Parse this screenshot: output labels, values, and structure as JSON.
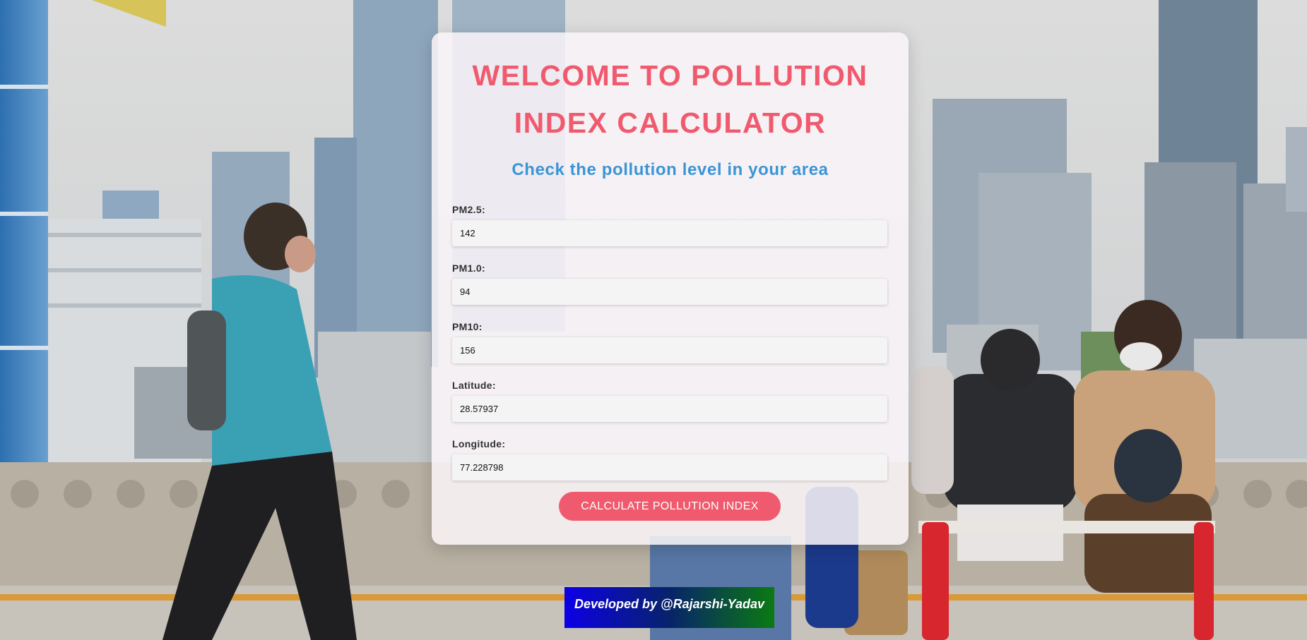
{
  "header": {
    "title_line1": "WELCOME TO POLLUTION",
    "title_line2": "INDEX CALCULATOR",
    "subtitle": "Check the pollution level in your area"
  },
  "form": {
    "fields": [
      {
        "label": "PM2.5:",
        "value": "142"
      },
      {
        "label": "PM1.0:",
        "value": "94"
      },
      {
        "label": "PM10:",
        "value": "156"
      },
      {
        "label": "Latitude:",
        "value": "28.57937"
      },
      {
        "label": "Longitude:",
        "value": "77.228798"
      }
    ],
    "submit_label": "CALCULATE POLLUTION INDEX"
  },
  "footer": {
    "credit": "Developed by @Rajarshi-Yadav"
  },
  "colors": {
    "accent": "#f05a6e",
    "subtitle": "#3a95d6",
    "footer_gradient_start": "#0c00e6",
    "footer_gradient_end": "#0b7a12"
  }
}
